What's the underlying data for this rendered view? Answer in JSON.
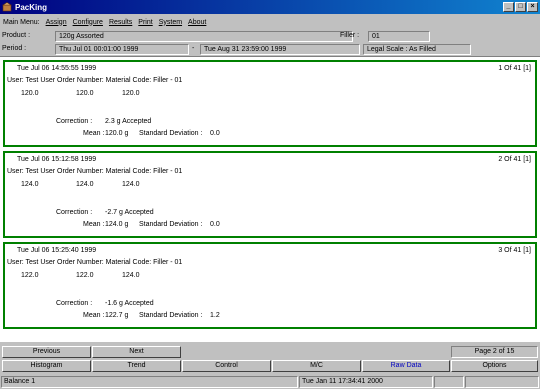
{
  "window": {
    "title": "PacKing"
  },
  "menu": {
    "prefix": "Main Menu:",
    "items": [
      "Assign",
      "Configure",
      "Results",
      "Print",
      "System",
      "About"
    ]
  },
  "product": {
    "label": "Product :",
    "value": "120g Assorted"
  },
  "filler": {
    "label": "Filler :",
    "value": "01"
  },
  "period": {
    "label": "Period :",
    "start": "Thu Jul 01 00:01:00 1999",
    "separator": "-",
    "end": "Tue Aug 31 23:59:00 1999",
    "legal_scale": "Legal Scale : As Filled"
  },
  "records": [
    {
      "timestamp": "Tue Jul 06 14:55:55 1999",
      "index": "1 Of 41 [1]",
      "info": "User: Test User  Order Number:  Material Code:  Filler - 01",
      "weights": [
        "120.0",
        "120.0",
        "120.0"
      ],
      "correction_label": "Correction :",
      "correction": "2.3 g  Accepted",
      "mean_label": "Mean :",
      "mean": "120.0 g",
      "sd_label": "Standard Deviation :",
      "sd": "0.0"
    },
    {
      "timestamp": "Tue Jul 06 15:12:58 1999",
      "index": "2 Of 41 [1]",
      "info": "User: Test User  Order Number:  Material Code:  Filler - 01",
      "weights": [
        "124.0",
        "124.0",
        "124.0"
      ],
      "correction_label": "Correction :",
      "correction": "-2.7 g  Accepted",
      "mean_label": "Mean :",
      "mean": "124.0 g",
      "sd_label": "Standard Deviation :",
      "sd": "0.0"
    },
    {
      "timestamp": "Tue Jul 06 15:25:40 1999",
      "index": "3 Of 41 [1]",
      "info": "User: Test User  Order Number:  Material Code:  Filler - 01",
      "weights": [
        "122.0",
        "122.0",
        "124.0"
      ],
      "correction_label": "Correction :",
      "correction": "-1.6 g  Accepted",
      "mean_label": "Mean :",
      "mean": "122.7 g",
      "sd_label": "Standard Deviation :",
      "sd": "1.2"
    }
  ],
  "nav": {
    "previous": "Previous",
    "next": "Next",
    "page": "Page 2 of 15"
  },
  "tabs": [
    "Histogram",
    "Trend",
    "Control",
    "M/C",
    "Raw Data",
    "Options"
  ],
  "status": {
    "left": "Balance 1",
    "datetime": "Tue Jan 11 17:34:41 2000"
  },
  "colors": {
    "title_bar": "#000080",
    "card_border": "#008000",
    "active_tab": "#0000c0"
  }
}
